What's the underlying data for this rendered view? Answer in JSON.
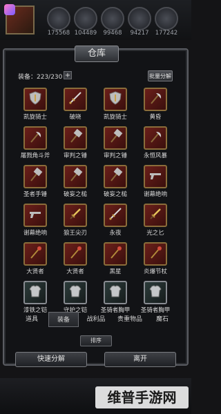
{
  "resources": [
    "175568",
    "104489",
    "99468",
    "94217",
    "177242"
  ],
  "window": {
    "title": "仓库",
    "equip_count": "装备：223/230",
    "plus_label": "+",
    "batch_label": "批量分解"
  },
  "items": [
    {
      "label": "凯旋骑士",
      "icon": "shield-icon"
    },
    {
      "label": "破晓",
      "icon": "sword-icon"
    },
    {
      "label": "凯旋骑士",
      "icon": "shield-icon"
    },
    {
      "label": "黄昏",
      "icon": "axe-icon"
    },
    {
      "label": "屠戮角斗斧",
      "icon": "axe-icon"
    },
    {
      "label": "审判之锤",
      "icon": "hammer-icon"
    },
    {
      "label": "审判之锤",
      "icon": "hammer-icon"
    },
    {
      "label": "永恒风暴",
      "icon": "axe-icon"
    },
    {
      "label": "圣者手锤",
      "icon": "hammer-icon"
    },
    {
      "label": "破妄之槌",
      "icon": "hammer-icon"
    },
    {
      "label": "破妄之槌",
      "icon": "hammer-icon"
    },
    {
      "label": "谢幕绝响",
      "icon": "gun-icon"
    },
    {
      "label": "谢幕绝响",
      "icon": "gun-icon"
    },
    {
      "label": "狼王尖刃",
      "icon": "dagger-icon"
    },
    {
      "label": "永夜",
      "icon": "sword-icon"
    },
    {
      "label": "光之匕",
      "icon": "dagger-icon"
    },
    {
      "label": "大贤者",
      "icon": "staff-icon"
    },
    {
      "label": "大贤者",
      "icon": "staff-icon"
    },
    {
      "label": "黑星",
      "icon": "staff-icon"
    },
    {
      "label": "炎爆节杖",
      "icon": "staff-icon"
    },
    {
      "label": "漆铁之铠",
      "icon": "armor-icon"
    },
    {
      "label": "守护之铠",
      "icon": "armor-icon"
    },
    {
      "label": "圣骑者胸甲",
      "icon": "armor-icon"
    },
    {
      "label": "圣骑者胸甲",
      "icon": "armor-icon"
    }
  ],
  "tabs": [
    "道具",
    "装备",
    "战利品",
    "贵重物品",
    "魔石"
  ],
  "active_tab": "装备",
  "sort_label": "排序",
  "quick_decompose_label": "快速分解",
  "leave_label": "离开",
  "watermark": "维普手游网"
}
